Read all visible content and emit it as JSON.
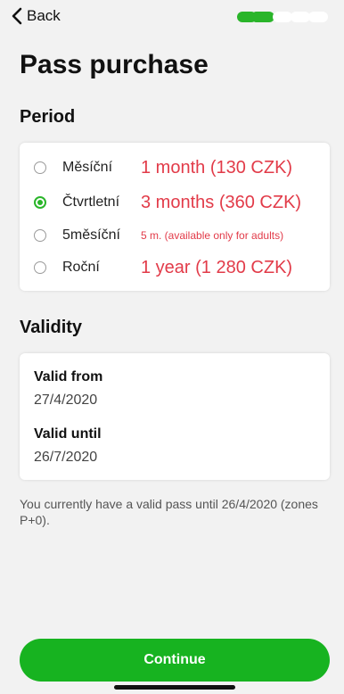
{
  "nav": {
    "back_label": "Back"
  },
  "progress": {
    "steps_total": 5,
    "steps_done": 2
  },
  "title": "Pass purchase",
  "period": {
    "heading": "Period",
    "options": [
      {
        "label": "Měsíční",
        "price": "1 month (130 CZK)",
        "selected": false
      },
      {
        "label": "Čtvrtletní",
        "price": "3 months (360 CZK)",
        "selected": true
      },
      {
        "label": "5měsíční",
        "price": "5 m. (available only for adults)",
        "selected": false
      },
      {
        "label": "Roční",
        "price": "1 year (1 280 CZK)",
        "selected": false
      }
    ]
  },
  "validity": {
    "heading": "Validity",
    "from_label": "Valid from",
    "from_value": "27/4/2020",
    "until_label": "Valid until",
    "until_value": "26/7/2020"
  },
  "note": "You currently have a valid pass until 26/4/2020 (zones P+0).",
  "continue_label": "Continue",
  "colors": {
    "accent": "#17b320",
    "price": "#e23b49"
  }
}
